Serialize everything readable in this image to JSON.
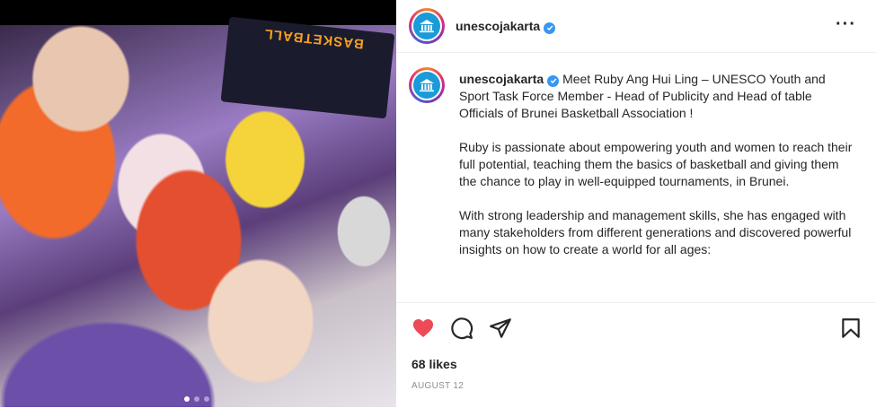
{
  "post": {
    "username": "unescojakarta",
    "more_icon": "more-horizontal-icon",
    "photo_banner_text": "BASKETBALL",
    "carousel_dots": 3,
    "carousel_active_index": 0
  },
  "caption": {
    "username": "unescojakarta",
    "paragraphs": [
      "Meet Ruby Ang Hui Ling –  UNESCO Youth and Sport Task Force Member -  Head of Publicity and Head of table Officials of  Brunei Basketball Association !",
      "Ruby is passionate about empowering youth and women to reach their full potential, teaching them the basics of basketball and giving them the chance to play in well-equipped tournaments, in Brunei.",
      "With strong leadership and management skills, she has engaged with many stakeholders from different generations and discovered powerful insights on how to create a world for all ages:"
    ]
  },
  "actions": {
    "like_icon": "heart-icon",
    "comment_icon": "comment-icon",
    "share_icon": "send-icon",
    "save_icon": "bookmark-icon",
    "liked_color": "#ed4956"
  },
  "likes_text": "68 likes",
  "date_text": "AUGUST 12"
}
